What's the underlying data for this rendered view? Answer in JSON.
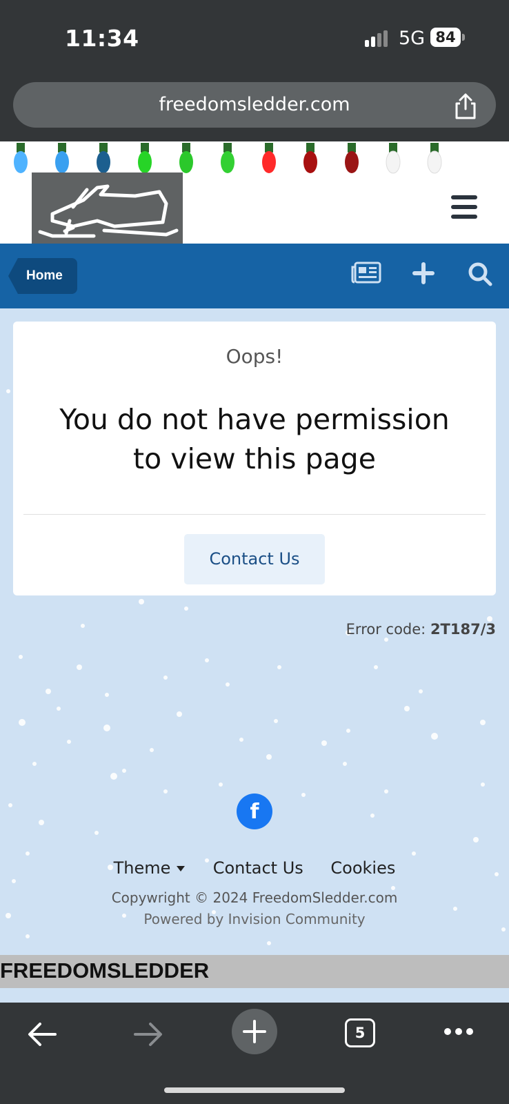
{
  "status_bar": {
    "time": "11:34",
    "network": "5G",
    "battery": "84"
  },
  "browser": {
    "url": "freedomsledder.com",
    "tab_count": "5"
  },
  "nav": {
    "home_label": "Home"
  },
  "error_card": {
    "oops": "Oops!",
    "message": "You do not have permission to view this page",
    "contact_button": "Contact Us"
  },
  "error_code": {
    "label": "Error code:",
    "code": "2T187/3"
  },
  "footer": {
    "facebook_icon": "f",
    "links": [
      "Theme",
      "Contact Us",
      "Cookies"
    ],
    "copyright": "Copywright © 2024 FreedomSledder.com",
    "powered": "Powered by Invision Community",
    "brand": "FREEDOMSLEDDER"
  },
  "colors": {
    "nav_blue": "#1663a5",
    "home_button": "#0e4a7e",
    "page_background": "#cfe1f3",
    "facebook_blue": "#1877f2",
    "browser_chrome": "#333638"
  },
  "icons": [
    "signal-icon",
    "share-icon",
    "menu-icon",
    "snowmobile-logo",
    "newspaper-icon",
    "plus-icon",
    "search-icon",
    "facebook-icon",
    "back-arrow-icon",
    "forward-arrow-icon",
    "new-tab-icon",
    "more-icon"
  ]
}
